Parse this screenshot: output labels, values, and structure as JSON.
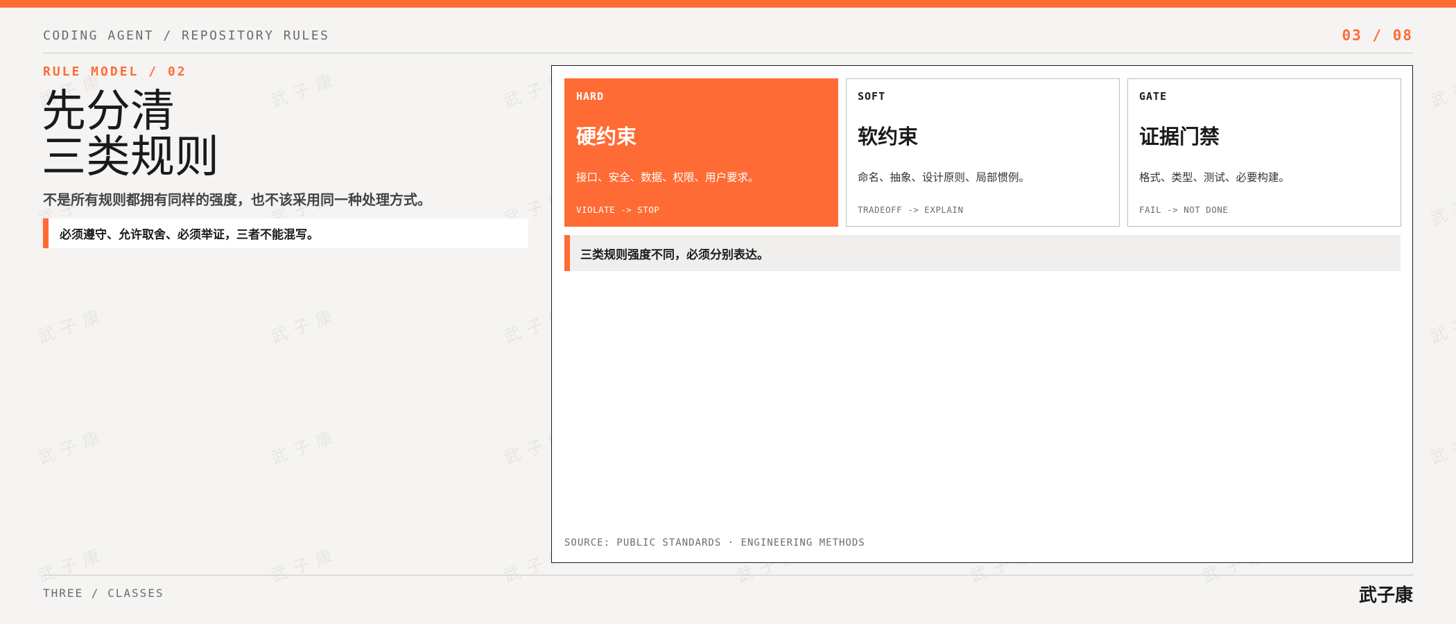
{
  "header": {
    "breadcrumb": "CODING AGENT / REPOSITORY RULES",
    "page_counter": "03 / 08"
  },
  "left": {
    "eyebrow": "RULE MODEL / 02",
    "title_lines": [
      "先分清",
      "三类规则"
    ],
    "subtitle": "不是所有规则都拥有同样的强度，也不该采用同一种处理方式。",
    "callout": "必须遵守、允许取舍、必须举证，三者不能混写。"
  },
  "cards": [
    {
      "tag": "HARD",
      "heading": "硬约束",
      "desc": "接口、安全、数据、权限、用户要求。",
      "rule": "VIOLATE -> STOP"
    },
    {
      "tag": "SOFT",
      "heading": "软约束",
      "desc": "命名、抽象、设计原则、局部惯例。",
      "rule": "TRADEOFF -> EXPLAIN"
    },
    {
      "tag": "GATE",
      "heading": "证据门禁",
      "desc": "格式、类型、测试、必要构建。",
      "rule": "FAIL -> NOT DONE"
    }
  ],
  "panel": {
    "note": "三类规则强度不同，必须分别表达。",
    "source": "SOURCE: PUBLIC STANDARDS · ENGINEERING METHODS"
  },
  "footer": {
    "left": "THREE / CLASSES",
    "author": "武子康"
  },
  "watermark": "武子康",
  "colors": {
    "accent": "#ff6b35",
    "background": "#f5f4f2",
    "panel": "#ffffff",
    "text": "#1a1a1a"
  }
}
